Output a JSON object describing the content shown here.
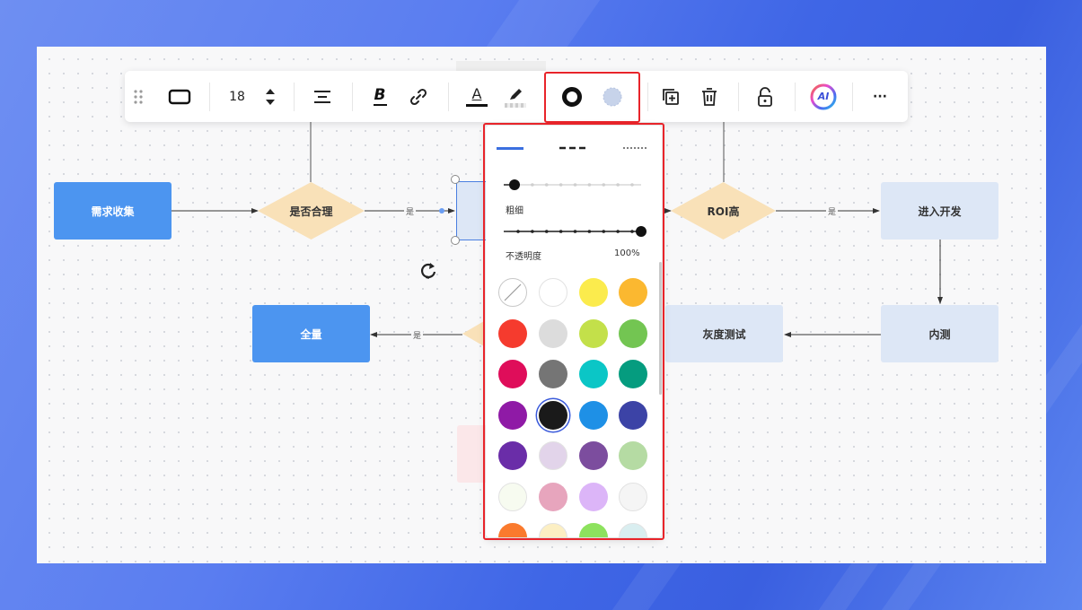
{
  "toolbar": {
    "font_size": "18",
    "bold_label": "B",
    "text_color_label": "A",
    "ai_label": "AI",
    "more_label": "···"
  },
  "flowchart": {
    "nodes": {
      "req": "需求收集",
      "reasonable": "是否合理",
      "roi": "ROI高",
      "dev": "进入开发",
      "internal": "内测",
      "gray": "灰度测试",
      "full": "全量"
    },
    "edge_yes": "是"
  },
  "style_panel": {
    "thickness_label": "粗细",
    "opacity_label": "不透明度",
    "opacity_value": "100%",
    "thickness_level": 0,
    "opacity_level": 1.0,
    "selected_color": "#1a1a1a",
    "colors": [
      "none",
      "#ffffff",
      "#fbeb4d",
      "#fbb830",
      "#f53b2e",
      "#dcdcdc",
      "#c3e04a",
      "#73c552",
      "#df0d5a",
      "#757575",
      "#0bc6c6",
      "#059c7f",
      "#8f1aa6",
      "#1a1a1a",
      "#1e90e6",
      "#3c43a6",
      "#6a2da8",
      "#e2d4ea",
      "#7c4d9e",
      "#b5dba3",
      "#f7fbf0",
      "#e7a5bd",
      "#dcb5f8",
      "#f5f5f5",
      "#fa7a2d",
      "#fcefc3",
      "#8de25e",
      "#d9eef0"
    ]
  }
}
